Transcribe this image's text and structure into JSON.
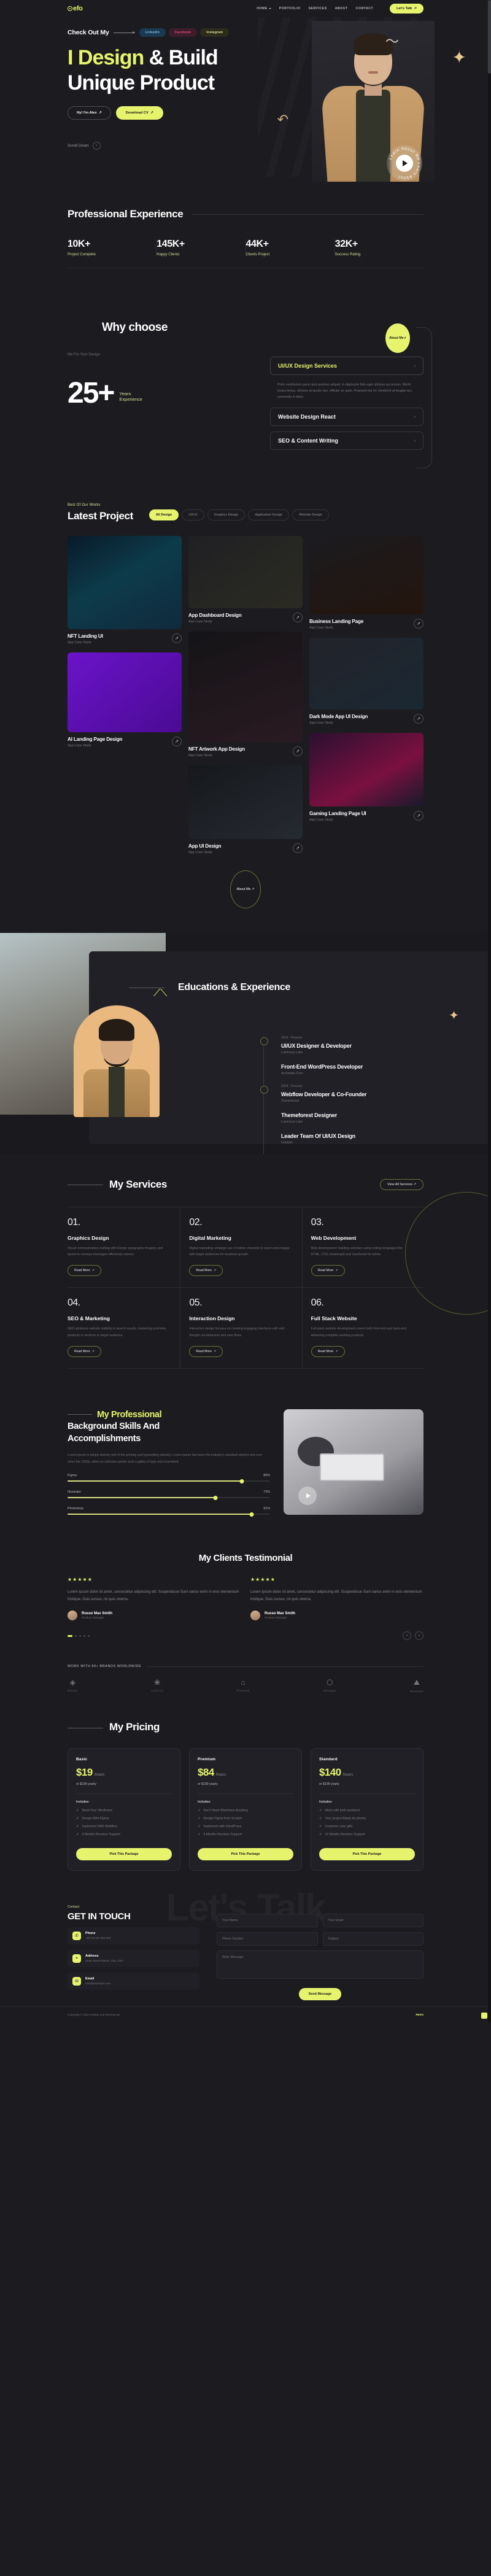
{
  "brand": {
    "logo": "efo",
    "colors": {
      "accent": "#e6f46d",
      "bg": "#1c1c20",
      "panel": "#202026"
    }
  },
  "nav": {
    "links": [
      {
        "label": "HOME",
        "has_dropdown": true
      },
      {
        "label": "PORTFOLIO",
        "has_dropdown": false
      },
      {
        "label": "SERVICES",
        "has_dropdown": false
      },
      {
        "label": "ABOUT",
        "has_dropdown": false
      },
      {
        "label": "CONTACT",
        "has_dropdown": false
      }
    ],
    "cta": "Let's Talk"
  },
  "hero": {
    "check_label": "Check Out My",
    "socials": [
      "Linkedin",
      "Facebook",
      "Instagram"
    ],
    "title_line1_highlight": "I Design",
    "title_line1_rest": " & Build",
    "title_line2": "Unique Product",
    "btn_primary": "Hy! I'm Alex",
    "btn_secondary": "Download CV",
    "scroll_label": "Scroll Down",
    "play_ring_text": "Learn About Me"
  },
  "experience": {
    "title": "Professional Experience",
    "stats": [
      {
        "value": "10K+",
        "label": "Project Complete"
      },
      {
        "value": "145K+",
        "label": "Happy Clients"
      },
      {
        "value": "44K+",
        "label": "Clients Project"
      },
      {
        "value": "32K+",
        "label": "Success Rating"
      }
    ]
  },
  "why": {
    "title": "Why choose",
    "subtitle": "Me For Your Design",
    "years_number": "25+",
    "years_label_1": "Years",
    "years_label_2": "Experience",
    "about_btn": "About Me",
    "accordion": [
      {
        "title": "UI/UX Design Services",
        "open": true,
        "body": "Proin vestibulum purus quis pulvinar aliquet. In dignissim felis eget ultricies accumsan. Morbi lectus lectus, ultricies at iaculis nec, efficitur ac justo. Praesent dui mi, hendrerit at feugiat nec, commodo in dolor."
      },
      {
        "title": "Website Design React",
        "open": false,
        "body": ""
      },
      {
        "title": "SEO & Content Writing",
        "open": false,
        "body": ""
      }
    ]
  },
  "projects": {
    "eyebrow": "Best Of Our Works",
    "title": "Latest Project",
    "filters": [
      "All Design",
      "UI/UX",
      "Graphics Design",
      "Application Design",
      "Website Design"
    ],
    "active_filter": "All Design",
    "about_btn": "About Me",
    "items": [
      {
        "title": "NFT Landing UI",
        "subtitle": "App Case Study",
        "thumb": "t1",
        "col": 1
      },
      {
        "title": "AI Landing Page Design",
        "subtitle": "App Case Study",
        "thumb": "t6",
        "col": 1
      },
      {
        "title": "App Dashboard Design",
        "subtitle": "App Case Study",
        "thumb": "t2",
        "col": 2
      },
      {
        "title": "NFT Artwork App Design",
        "subtitle": "App Case Study",
        "thumb": "t4",
        "col": 2
      },
      {
        "title": "App UI Design",
        "subtitle": "App Case Study",
        "thumb": "t7",
        "col": 2
      },
      {
        "title": "Business Landing Page",
        "subtitle": "App Case Study",
        "thumb": "t3",
        "col": 3
      },
      {
        "title": "Dark Mode App UI Design",
        "subtitle": "App Case Study",
        "thumb": "t5",
        "col": 3
      },
      {
        "title": "Gaming Landing Page UI",
        "subtitle": "App Case Study",
        "thumb": "t8",
        "col": 3
      }
    ]
  },
  "education": {
    "title": "Educations & Experience",
    "timeline": [
      {
        "date": "2019 - Present",
        "role": "UI/UX Designer & Developer",
        "org": "Luminous Labs",
        "has_dot": true
      },
      {
        "date": "",
        "role": "Front-End WordPress Developer",
        "org": "Archimple.Com",
        "has_dot": false
      },
      {
        "date": "2024 - Present",
        "role": "Webflow Developer & Co-Founder",
        "org": "Themeforest",
        "has_dot": true
      },
      {
        "date": "",
        "role": "Themeforest Designer",
        "org": "Luminous Labs",
        "has_dot": false
      },
      {
        "date": "",
        "role": "Leader Team Of UI/UX Design",
        "org": "Dribbble",
        "has_dot": false
      }
    ]
  },
  "services": {
    "title": "My Services",
    "view_all": "View All Services",
    "read_more": "Read More",
    "items": [
      {
        "num": "01.",
        "name": "Graphics Design",
        "desc": "Visual communication crafting with Design typography imagery, and layout to conveys messages effectively various."
      },
      {
        "num": "02.",
        "name": "Digital Marketing",
        "desc": "Digital marketing: strategic use of online channels to reach and engage with target audiences for business growth."
      },
      {
        "num": "03.",
        "name": "Web Development",
        "desc": "Web development: building websites using coding languages like HTML, CSS, bootstrap5 and JavaScript for online."
      },
      {
        "num": "04.",
        "name": "SEO & Marketing",
        "desc": "SEO optimizes website visibility in search results, marketing promotes products or services to target audience."
      },
      {
        "num": "05.",
        "name": "Interaction Design",
        "desc": "Interaction design focuses on creating engaging interfaces with well thought out behaviors and user flows."
      },
      {
        "num": "06.",
        "name": "Full Stack Website",
        "desc": "Full stack website development covers both front-end and back-end, delivering complete working products."
      }
    ]
  },
  "skills": {
    "title_line1": "My Professional",
    "title_line2": "Background Skills And",
    "title_line3": "Accomplishments",
    "desc": "Lorem ipsum is simply dummy text of the printing and typesetting industry. Lorem ipsum has been the industry's standard dummy text ever since the 1500s, when an unknown printer took a galley of type and scrambled.",
    "bars": [
      {
        "name": "Figma",
        "value": "86%",
        "pct": 86
      },
      {
        "name": "Illustrator",
        "value": "73%",
        "pct": 73
      },
      {
        "name": "Photoshop",
        "value": "91%",
        "pct": 91
      }
    ]
  },
  "testimonial": {
    "title": "My Clients Testimonial",
    "items": [
      {
        "stars": "★★★★★",
        "text": "Lorem ipsum dolor sit amet, consectetur adipiscing elit. Suspendisse Sunt varius enim in eros elementum tristique. Duis cursus, mi quis viverra.",
        "name": "Russo Max Smith",
        "role": "Product Manager"
      },
      {
        "stars": "★★★★★",
        "text": "Lorem ipsum dolor sit amet, consectetur adipiscing elit. Suspendisse Sunt varius enim in eros elementum tristique. Duis cursus, mi quis viverra.",
        "name": "Russo Max Smith",
        "role": "Product Manager"
      }
    ]
  },
  "brands": {
    "label": "WORK WITH 60+ BRANDS WORLDWIDE",
    "items": [
      "Envato",
      "Leaf Co",
      "Pinnacle",
      "Hexagon",
      "Mountain"
    ]
  },
  "pricing": {
    "title": "My Pricing",
    "includes_label": "Includes:",
    "button": "Pick This Package",
    "plans": [
      {
        "name": "Basic",
        "price": "$19",
        "unit": "/hours",
        "yearly": "or $199 yearly",
        "features": [
          "Need Your Wireframe",
          "Design With Figma",
          "Implement With Webflow",
          "4 Months Revision Support"
        ]
      },
      {
        "name": "Premium",
        "price": "$84",
        "unit": "/hours",
        "yearly": "or $199 yearly",
        "features": [
          "Don't Need Wireframe Anything",
          "Design Figma from Scratch",
          "Implement with WordPress",
          "6 Months Revision Support"
        ]
      },
      {
        "name": "Standard",
        "price": "$140",
        "unit": "/hours",
        "yearly": "or $199 yearly",
        "features": [
          "Work with both weekend",
          "Your project Alway be priority",
          "Customer care gifts",
          "12 Months Revision Support"
        ]
      }
    ]
  },
  "contact": {
    "bigword": "Let's Talk",
    "eyebrow": "Contact",
    "title": "GET IN TOUCH",
    "items": [
      {
        "icon": "phone-icon",
        "glyph": "✆",
        "key": "Phone",
        "value": "+88 01700 000 000"
      },
      {
        "icon": "location-icon",
        "glyph": "⌖",
        "key": "Address",
        "value": "1234 Street Name, City, USA"
      },
      {
        "icon": "mail-icon",
        "glyph": "✉",
        "key": "Email",
        "value": "info@example.com"
      }
    ],
    "form": {
      "name_placeholder": "Your Name",
      "email_placeholder": "Your Email",
      "phone_placeholder": "Phone Number",
      "subject_placeholder": "Subject",
      "message_placeholder": "Write Message",
      "submit": "Send Message"
    }
  },
  "footer": {
    "copyright": "Copyright © 2024 Design and Develop By",
    "badge": "PEFO"
  }
}
